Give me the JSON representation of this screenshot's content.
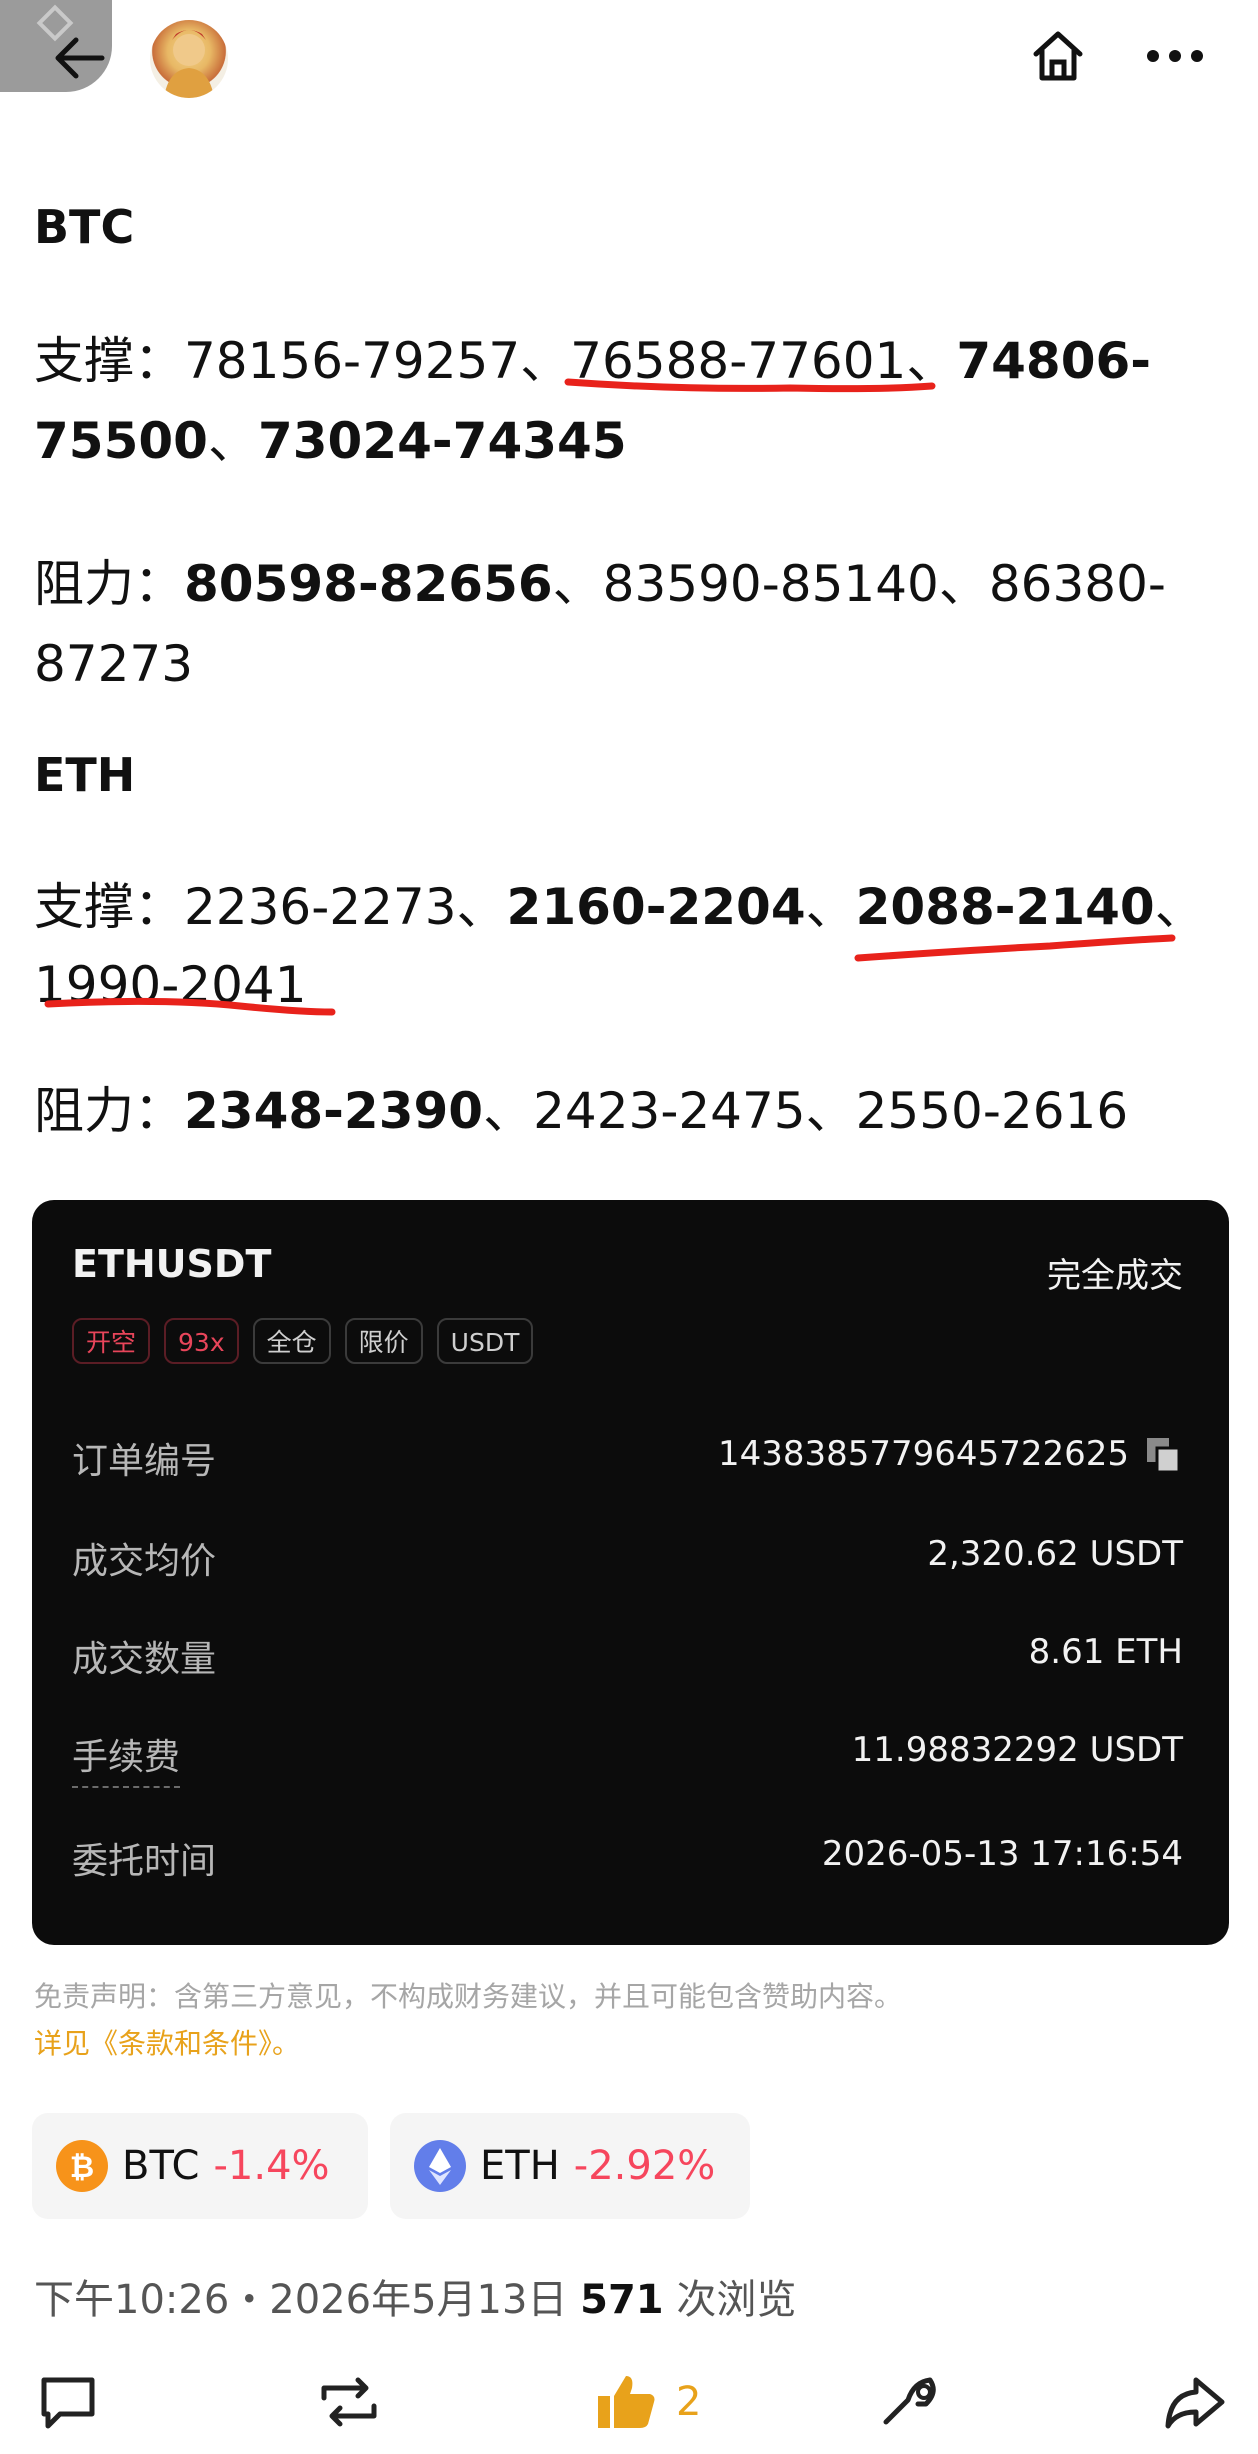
{
  "header": {
    "back_icon": "arrow-left-icon",
    "home_icon": "home-icon",
    "more_icon": "more-dots-icon"
  },
  "btc": {
    "title": "BTC",
    "support_label": "支撑：",
    "support_1": "78156-79257",
    "sep1": "、",
    "support_2": "76588-77601",
    "sep2": "、",
    "support_3a": "74806-",
    "support_3b": "75500",
    "sep3": "、",
    "support_4": "73024-74345",
    "resistance_label": "阻力：",
    "resistance_1": "80598-82656",
    "sep4": "、",
    "resistance_2": "83590-85140",
    "sep5": "、",
    "resistance_3a": "86380-",
    "resistance_3b": "87273"
  },
  "eth": {
    "title": "ETH",
    "support_label": "支撑：",
    "support_1": "2236-2273",
    "sep1": "、",
    "support_2": "2160-2204",
    "sep2": "、",
    "support_3": "2088-2140",
    "sep3": "、",
    "support_4": "1990-2041",
    "resistance_label": "阻力：",
    "resistance_1": "2348-2390",
    "sep4": "、",
    "resistance_2": "2423-2475",
    "sep5": "、",
    "resistance_3": "2550-2616"
  },
  "order": {
    "symbol": "ETHUSDT",
    "status": "完全成交",
    "tags": [
      "开空",
      "93x",
      "全仓",
      "限价",
      "USDT"
    ],
    "rows": [
      {
        "label": "订单编号",
        "value": "1438385779645722625"
      },
      {
        "label": "成交均价",
        "value": "2,320.62 USDT"
      },
      {
        "label": "成交数量",
        "value": "8.61 ETH"
      },
      {
        "label": "手续费",
        "value": "11.98832292 USDT"
      },
      {
        "label": "委托时间",
        "value": "2026-05-13 17:16:54"
      }
    ]
  },
  "disclaimer": "免责声明：含第三方意见，不构成财务建议，并且可能包含赞助内容。",
  "terms": "详见《条款和条件》。",
  "coins": [
    {
      "name": "BTC",
      "change": "-1.4%",
      "color": "#f7931a"
    },
    {
      "name": "ETH",
      "change": "-2.92%",
      "color": "#627eea"
    }
  ],
  "meta": {
    "time": "下午10:26・2026年5月13日",
    "views": "571",
    "views_label": "次浏览"
  },
  "actions": {
    "like_count": "2"
  },
  "colors": {
    "underline": "#e8221b",
    "negative": "#f6465d",
    "accent": "#e8a21b"
  }
}
